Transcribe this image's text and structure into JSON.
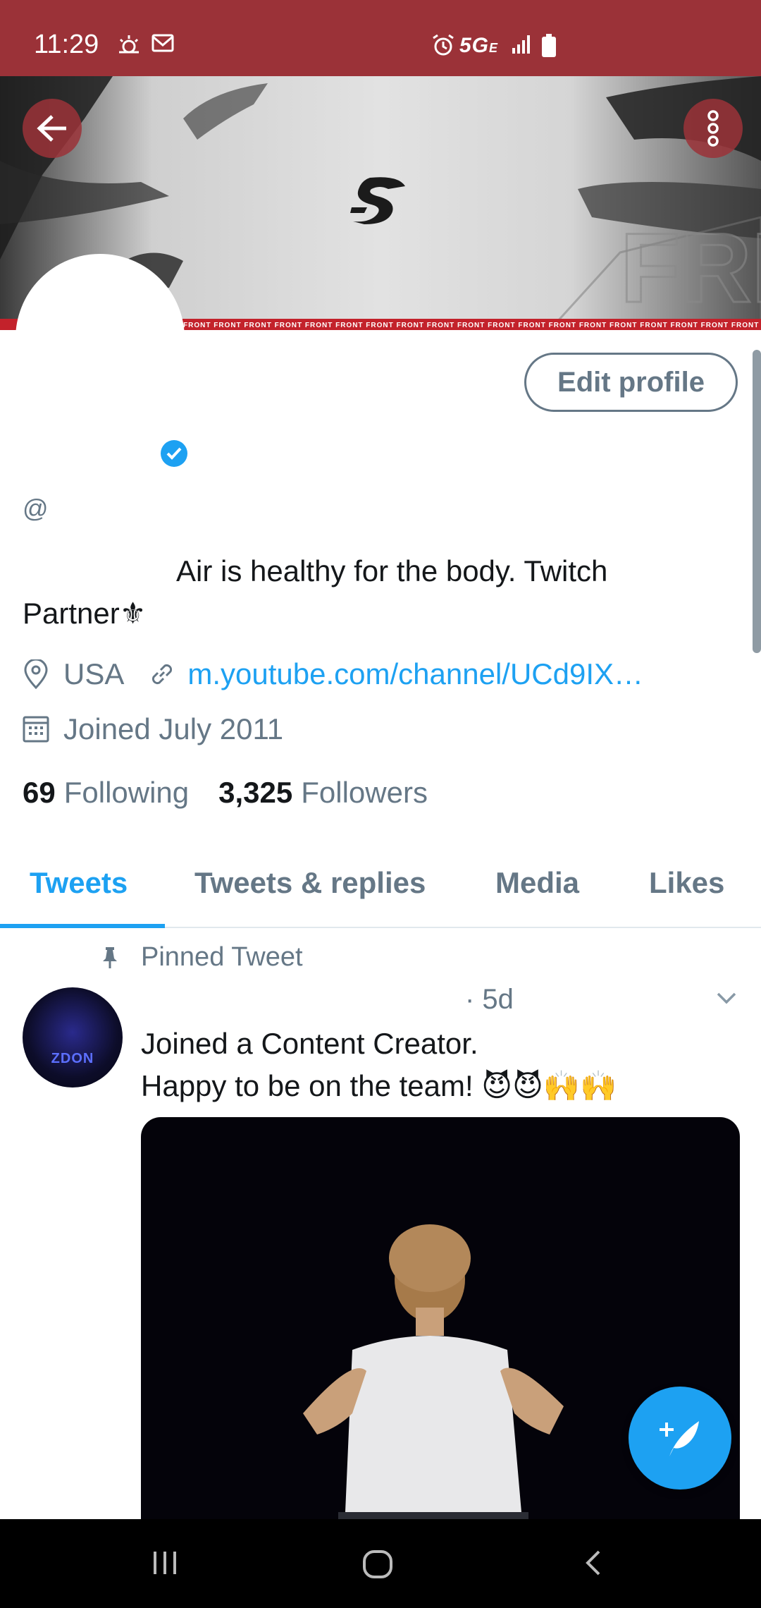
{
  "status_bar": {
    "time": "11:29",
    "network": "5G",
    "network_suffix": "E"
  },
  "banner": {
    "strip_text": "FRONT FRONT FRONT FRONT FRONT FRONT FRONT FRONT FRONT FRONT FRONT FRONT FRONT FRONT FRONT FRONT FRONT FRONT FRONT FRONT FRONT FRONT FRONT FRONT FRONT FRONT FRONT FRONT FRONT FRONT FRONT FRONT FRONT FRONT FRONT FRONT"
  },
  "profile": {
    "edit_button": "Edit profile",
    "handle": "@",
    "bio_line1": "Air is healthy for the body. Twitch",
    "bio_line2": "Partner⚜",
    "location": "USA",
    "link": "m.youtube.com/channel/UCd9IX…",
    "joined": "Joined July 2011",
    "following_count": "69",
    "following_label": "Following",
    "followers_count": "3,325",
    "followers_label": "Followers"
  },
  "tabs": [
    {
      "label": "Tweets"
    },
    {
      "label": "Tweets & replies"
    },
    {
      "label": "Media"
    },
    {
      "label": "Likes"
    }
  ],
  "tweet": {
    "pinned_label": "Pinned Tweet",
    "time": "· 5d",
    "text_line1": "Joined a Content Creator.",
    "text_line2": "Happy to be on the team! 😈😈🙌🙌",
    "avatar_text": "ZDON"
  },
  "colors": {
    "status_bar": "#9b3238",
    "accent": "#1da1f2",
    "muted": "#657786"
  }
}
